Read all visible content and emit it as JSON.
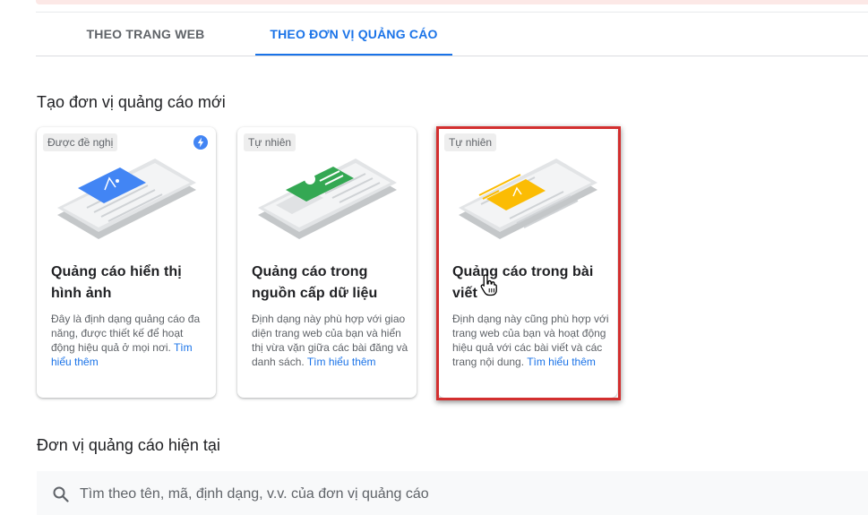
{
  "tabs": [
    {
      "label": "THEO TRANG WEB",
      "active": false
    },
    {
      "label": "THEO ĐƠN VỊ QUẢNG CÁO",
      "active": true
    }
  ],
  "create_section": {
    "title": "Tạo đơn vị quảng cáo mới",
    "cards": [
      {
        "badge": "Được đề nghị",
        "icon": "bolt-icon",
        "title": "Quảng cáo hiển thị hình ảnh",
        "description": "Đây là định dạng quảng cáo đa năng, được thiết kế để hoạt động hiệu quả ở mọi nơi.",
        "link": "Tìm hiểu thêm"
      },
      {
        "badge": "Tự nhiên",
        "title": "Quảng cáo trong nguồn cấp dữ liệu",
        "description": "Định dạng này phù hợp với giao diện trang web của bạn và hiển thị vừa vặn giữa các bài đăng và danh sách.",
        "link": "Tìm hiểu thêm"
      },
      {
        "badge": "Tự nhiên",
        "title": "Quảng cáo trong bài viết",
        "description": "Định dạng này cũng phù hợp với trang web của bạn và hoạt động hiệu quả với các bài viết và các trang nội dung.",
        "link": "Tìm hiểu thêm"
      }
    ]
  },
  "current_section": {
    "title": "Đơn vị quảng cáo hiện tại",
    "search": {
      "placeholder": "Tìm theo tên, mã, định dạng, v.v. của đơn vị quảng cáo",
      "value": ""
    }
  },
  "colors": {
    "accent": "#1a73e8",
    "display_ad": "#4285f4",
    "feed_ad": "#34a853",
    "article_ad": "#fbbc04",
    "highlight": "#d32f2f"
  }
}
